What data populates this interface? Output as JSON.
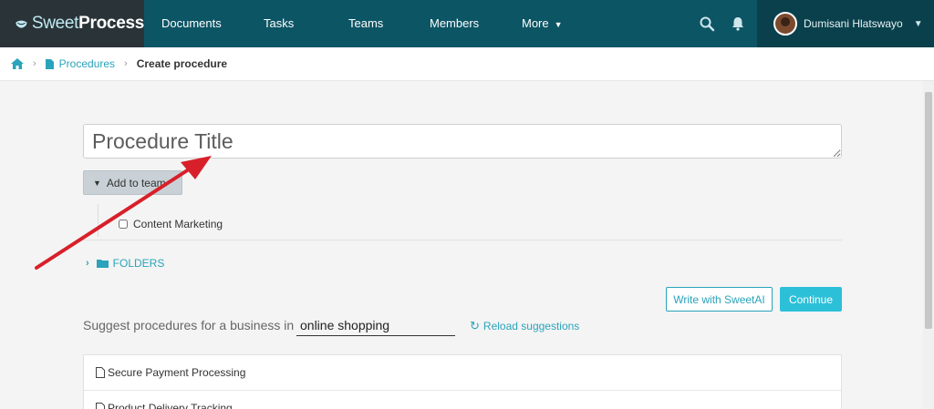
{
  "app": {
    "logo_light": "Sweet",
    "logo_bold": "Process"
  },
  "nav": {
    "items": [
      {
        "label": "Documents"
      },
      {
        "label": "Tasks"
      },
      {
        "label": "Teams"
      },
      {
        "label": "Members"
      },
      {
        "label": "More"
      }
    ],
    "icons": [
      "search-icon",
      "bell-icon"
    ],
    "user_name": "Dumisani Hlatswayo"
  },
  "breadcrumb": {
    "home_icon": "home-icon",
    "procedures": "Procedures",
    "current": "Create procedure"
  },
  "form": {
    "title_placeholder": "Procedure Title",
    "add_to_team": "Add to team",
    "teams": [
      {
        "label": "Content Marketing",
        "checked": false
      }
    ],
    "folders_label": "FOLDERS",
    "write_with_sweetai": "Write with SweetAI",
    "continue": "Continue"
  },
  "suggest": {
    "label": "Suggest procedures for a business in",
    "business": "online shopping",
    "reload": "Reload suggestions",
    "items": [
      {
        "label": "Secure Payment Processing"
      },
      {
        "label": "Product Delivery Tracking"
      }
    ]
  },
  "colors": {
    "nav_bg": "#0c5565",
    "logo_bg": "#2a3438",
    "accent": "#2aa3bb",
    "continue_bg": "#2cc0d8",
    "annotation_arrow": "#d8202a"
  }
}
